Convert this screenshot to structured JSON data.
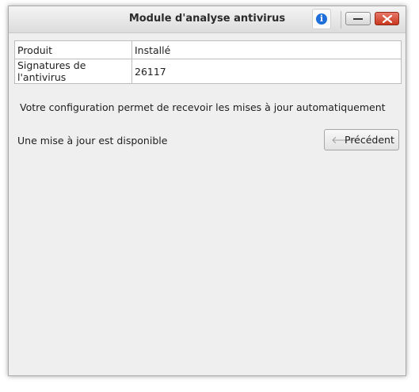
{
  "window": {
    "title": "Module d'analyse antivirus"
  },
  "titlebar_buttons": {
    "info_icon": "info-icon",
    "minimize_icon": "minimize-icon",
    "close_icon": "close-icon"
  },
  "table": {
    "rows": [
      {
        "label": "Produit",
        "value": "Installé"
      },
      {
        "label": "Signatures de l'antivirus",
        "value": "26117"
      }
    ]
  },
  "messages": {
    "config": "Votre configuration permet de recevoir les mises à jour automatiquement",
    "update": "Une mise à jour est disponible"
  },
  "buttons": {
    "previous_label": "Précédent",
    "previous_arrow": "🡐"
  },
  "colors": {
    "close_button": "#c8391f",
    "info_accent": "#1e6fd9"
  }
}
